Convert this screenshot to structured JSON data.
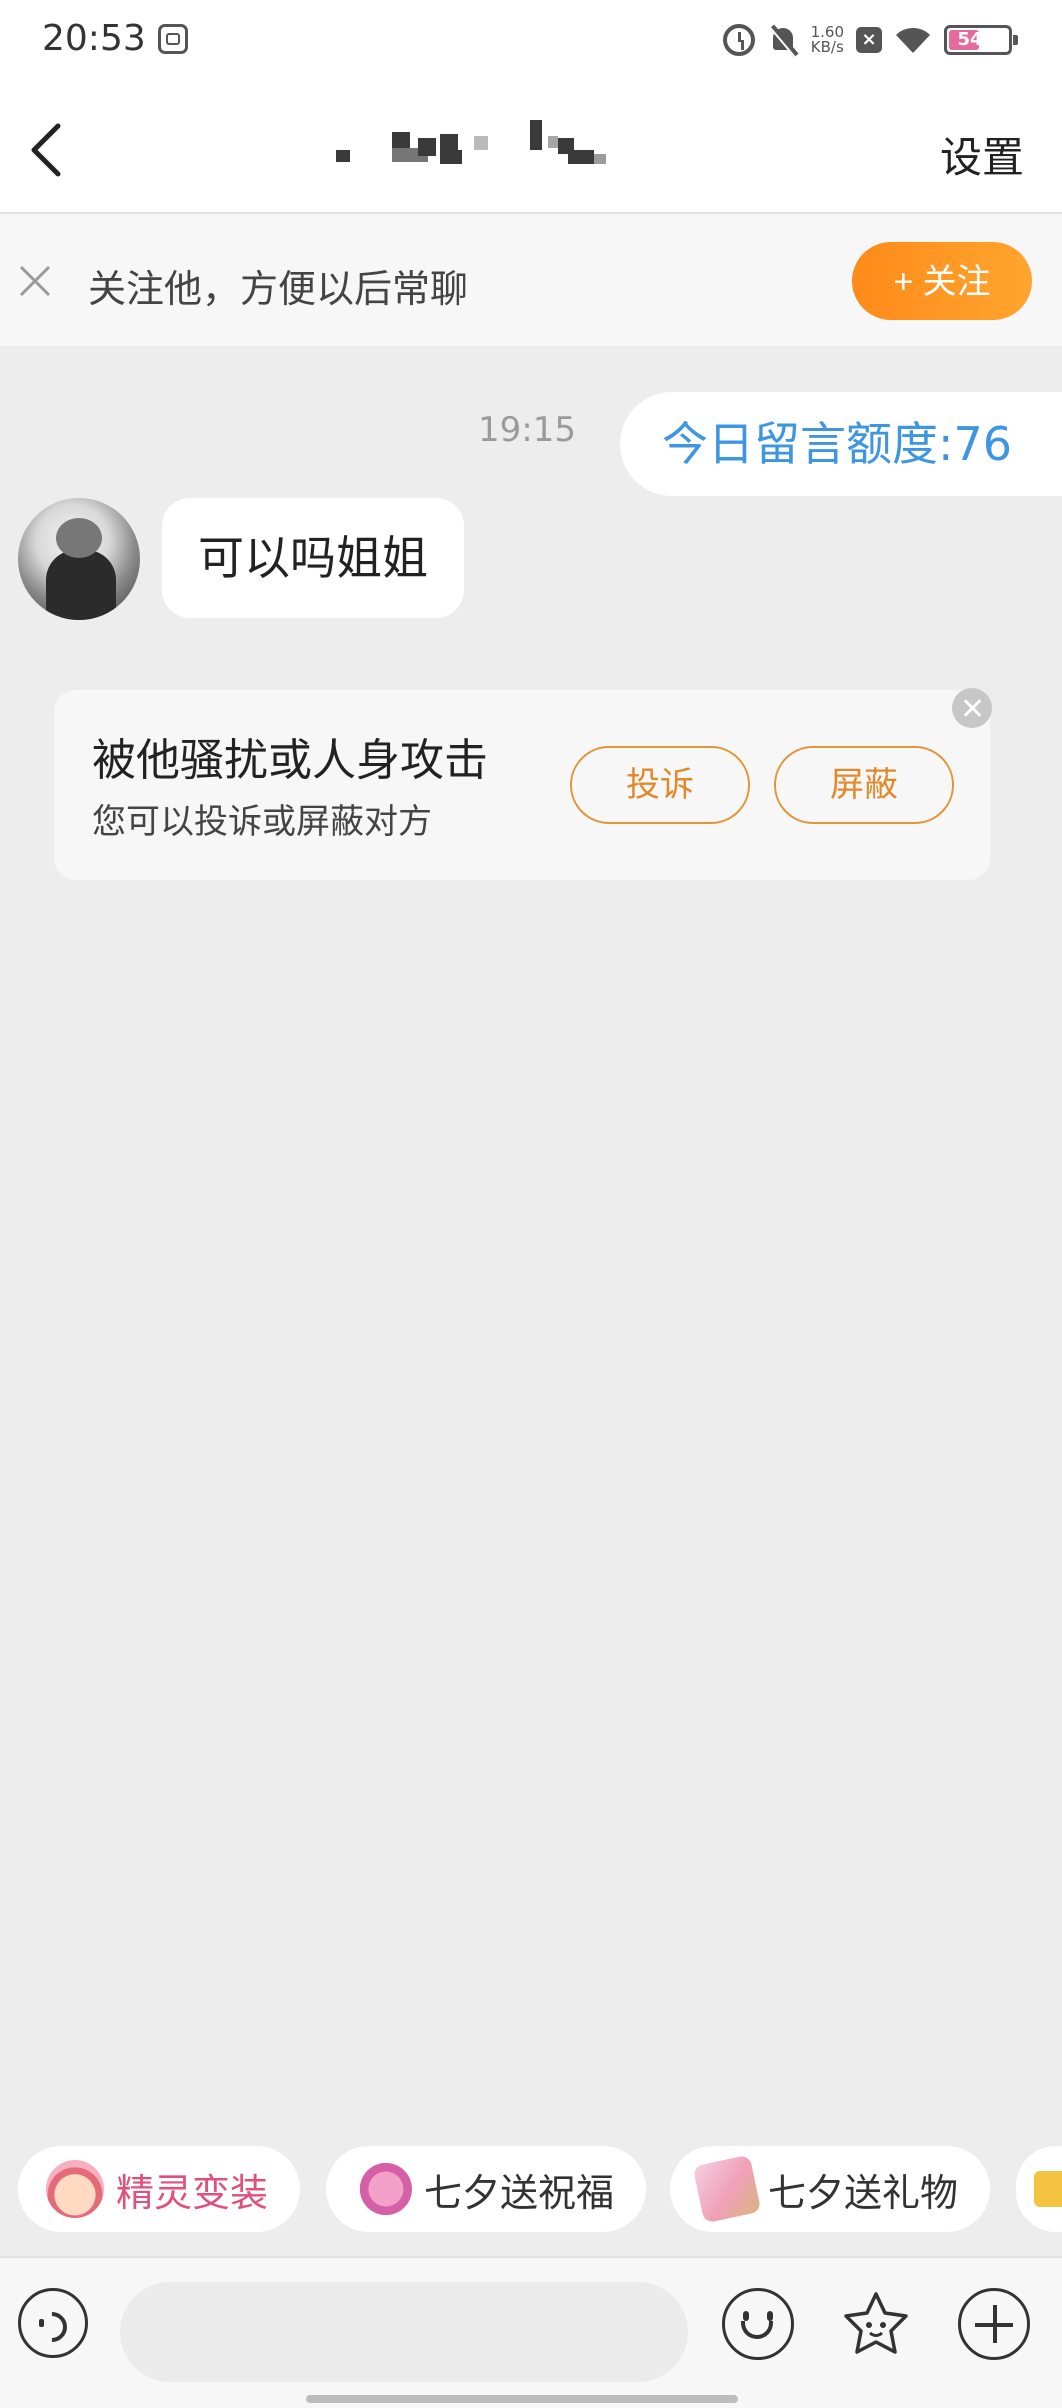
{
  "status_bar": {
    "time": "20:53",
    "net_speed_value": "1.60",
    "net_speed_unit": "KB/s",
    "battery_level": "54",
    "battery_color": "#e56b9c"
  },
  "header": {
    "title": "",
    "settings_label": "设置"
  },
  "follow_banner": {
    "text": "关注他，方便以后常聊",
    "follow_button": "+ 关注"
  },
  "messages": {
    "timestamp": "19:15",
    "outgoing": "今日留言额度:76",
    "incoming": "可以吗姐姐"
  },
  "report_card": {
    "title": "被他骚扰或人身攻击",
    "subtitle": "您可以投诉或屏蔽对方",
    "complain_button": "投诉",
    "block_button": "屏蔽"
  },
  "quick_chips": [
    {
      "label": "精灵变装",
      "icon": "elf-avatar-icon"
    },
    {
      "label": "七夕送祝福",
      "icon": "magpie-icon"
    },
    {
      "label": "七夕送礼物",
      "icon": "gift-card-icon"
    }
  ],
  "input_bar": {
    "placeholder": "",
    "icons": [
      "voice-icon",
      "emoji-icon",
      "sticker-icon",
      "plus-icon"
    ]
  },
  "colors": {
    "accent_orange": "#ff8a1a",
    "link_blue": "#3e95e0",
    "chip_pink": "#e0507a",
    "background": "#ededed"
  }
}
